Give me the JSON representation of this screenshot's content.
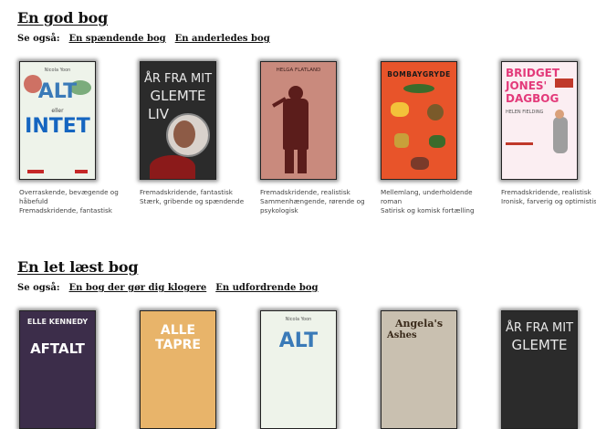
{
  "sections": [
    {
      "title": "En god bog",
      "see_label": "Se også:",
      "links": [
        "En spændende bog",
        "En anderledes bog"
      ],
      "books": [
        {
          "cover_title": "ALT",
          "cover_sub": "eller",
          "cover_title2": "INTET",
          "author": "Nicola Yoon",
          "tags": [
            "Overraskende, bevægende og",
            "håbefuld",
            "Fremadskridende, fantastisk"
          ]
        },
        {
          "cover_title": "ÅR FRA MIT",
          "cover_title2": "GLEMTE",
          "cover_title3": "LIV",
          "author": "",
          "tags": [
            "Fremadskridende, fantastisk",
            "Stærk, gribende og spændende"
          ]
        },
        {
          "cover_title": "HELGA FLATLAND",
          "author": "",
          "tags": [
            "Fremadskridende, realistisk",
            "Sammenhængende, rørende og",
            "psykologisk"
          ]
        },
        {
          "cover_title": "BOMBAYGRYDE",
          "author": "",
          "tags": [
            "Mellemlang, underholdende",
            "roman",
            "Satirisk og komisk fortælling"
          ]
        },
        {
          "cover_title": "BRIDGET",
          "cover_title2": "JONES'",
          "cover_title3": "DAGBOG",
          "author": "HELEN FIELDING",
          "tags": [
            "Fremadskridende, realistisk",
            "Ironisk, farverig og optimistisk"
          ]
        }
      ]
    },
    {
      "title": "En let læst bog",
      "see_label": "Se også:",
      "links": [
        "En bog der gør dig klogere",
        "En udfordrende bog"
      ],
      "books": [
        {
          "cover_title": "ELLE KENNEDY",
          "cover_title2": "AFTALT",
          "tags": []
        },
        {
          "cover_title": "ALLE",
          "cover_title2": "TAPRE",
          "tags": []
        },
        {
          "cover_title": "ALT",
          "author": "Nicola Yoon",
          "tags": []
        },
        {
          "cover_title": "Angela's",
          "cover_title2": "Ashes",
          "tags": []
        },
        {
          "cover_title": "ÅR FRA MIT",
          "cover_title2": "GLEMTE",
          "tags": []
        }
      ]
    }
  ]
}
